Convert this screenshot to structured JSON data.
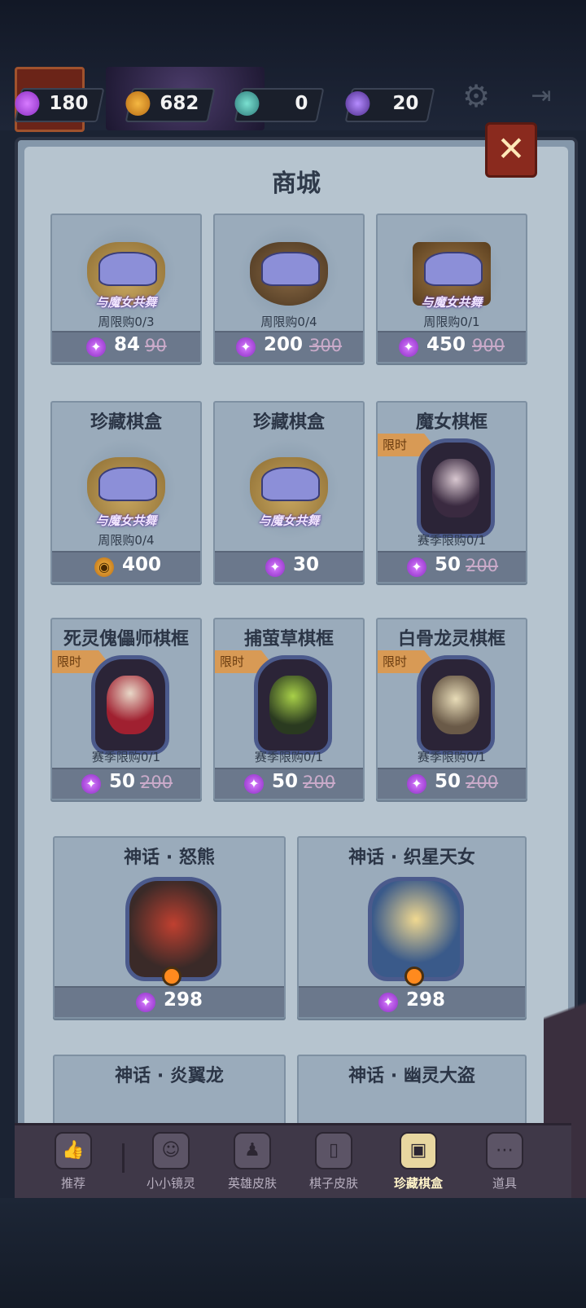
{
  "currencies": [
    {
      "icon": "candy-icon",
      "value": "180"
    },
    {
      "icon": "pumpkin-coin-icon",
      "value": "682"
    },
    {
      "icon": "potion-icon",
      "value": "0"
    },
    {
      "icon": "crystal-icon",
      "value": "20"
    }
  ],
  "shop": {
    "title": "商城",
    "bundles": [
      {
        "logo": "与魔女共舞",
        "limit": "周限购0/3",
        "price": "84",
        "old_price": "90"
      },
      {
        "logo": "与魔女共舞",
        "limit": "周限购0/4",
        "price": "200",
        "old_price": "300"
      },
      {
        "logo": "与魔女共舞",
        "limit": "周限购0/1",
        "price": "450",
        "old_price": "900"
      }
    ],
    "boxes": [
      {
        "name": "珍藏棋盒",
        "logo": "与魔女共舞",
        "limit": "周限购0/4",
        "price": "400",
        "currency": "pumpkin"
      },
      {
        "name": "珍藏棋盒",
        "logo": "与魔女共舞",
        "price": "30",
        "currency": "candy"
      },
      {
        "name": "魔女棋框",
        "tag": "限时",
        "limit": "赛季限购0/1",
        "price": "50",
        "old_price": "200"
      }
    ],
    "frames": [
      {
        "name": "死灵傀儡师棋框",
        "tag": "限时",
        "limit": "赛季限购0/1",
        "price": "50",
        "old_price": "200"
      },
      {
        "name": "捕萤草棋框",
        "tag": "限时",
        "limit": "赛季限购0/1",
        "price": "50",
        "old_price": "200"
      },
      {
        "name": "白骨龙灵棋框",
        "tag": "限时",
        "limit": "赛季限购0/1",
        "price": "50",
        "old_price": "200"
      }
    ],
    "heroes": [
      {
        "name": "神话 · 怒熊",
        "price": "298"
      },
      {
        "name": "神话 · 织星天女",
        "price": "298"
      },
      {
        "name": "神话 · 炎翼龙"
      },
      {
        "name": "神话 · 幽灵大盗"
      }
    ],
    "close_label": "✕"
  },
  "nav": [
    {
      "label": "推荐",
      "icon": "thumbs-up-icon",
      "glyph": "👍"
    },
    {
      "label": "小小镜灵",
      "icon": "mirror-spirit-icon",
      "glyph": "☺"
    },
    {
      "label": "英雄皮肤",
      "icon": "hero-skin-icon",
      "glyph": "♟"
    },
    {
      "label": "棋子皮肤",
      "icon": "chess-skin-icon",
      "glyph": "▯"
    },
    {
      "label": "珍藏棋盒",
      "icon": "treasure-box-icon",
      "glyph": "▣",
      "active": true
    },
    {
      "label": "道具",
      "icon": "items-icon",
      "glyph": "⋯"
    }
  ],
  "colors": {
    "accent_candy": "#c04ee8",
    "accent_pumpkin": "#e09a2a",
    "close": "#8a2a1e",
    "tag": "#d89a55"
  }
}
